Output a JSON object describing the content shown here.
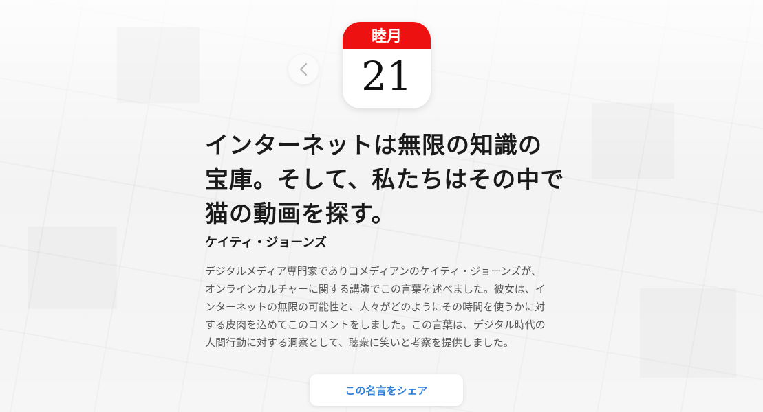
{
  "calendar": {
    "month": "睦月",
    "day": "21"
  },
  "quote": {
    "lines": [
      "インターネットは無限の知識の",
      "宝庫。そして、私たちはその中で",
      "猫の動画を探す。"
    ]
  },
  "author": "ケイティ・ジョーンズ",
  "description": {
    "lines": [
      "デジタルメディア専門家でありコメディアンのケイティ・ジョーンズが、",
      "オンラインカルチャーに関する講演でこの言葉を述べました。彼女は、イ",
      "ンターネットの無限の可能性と、人々がどのようにその時間を使うかに対",
      "する皮肉を込めてこのコメントをしました。この言葉は、デジタル時代の",
      "人間行動に対する洞察として、聴衆に笑いと考察を提供しました。"
    ]
  },
  "share_button_label": "この名言をシェア",
  "icons": {
    "back": "chevron-left-icon"
  },
  "colors": {
    "calendar_header": "#ee1111",
    "share_text": "#2f7fd9"
  }
}
